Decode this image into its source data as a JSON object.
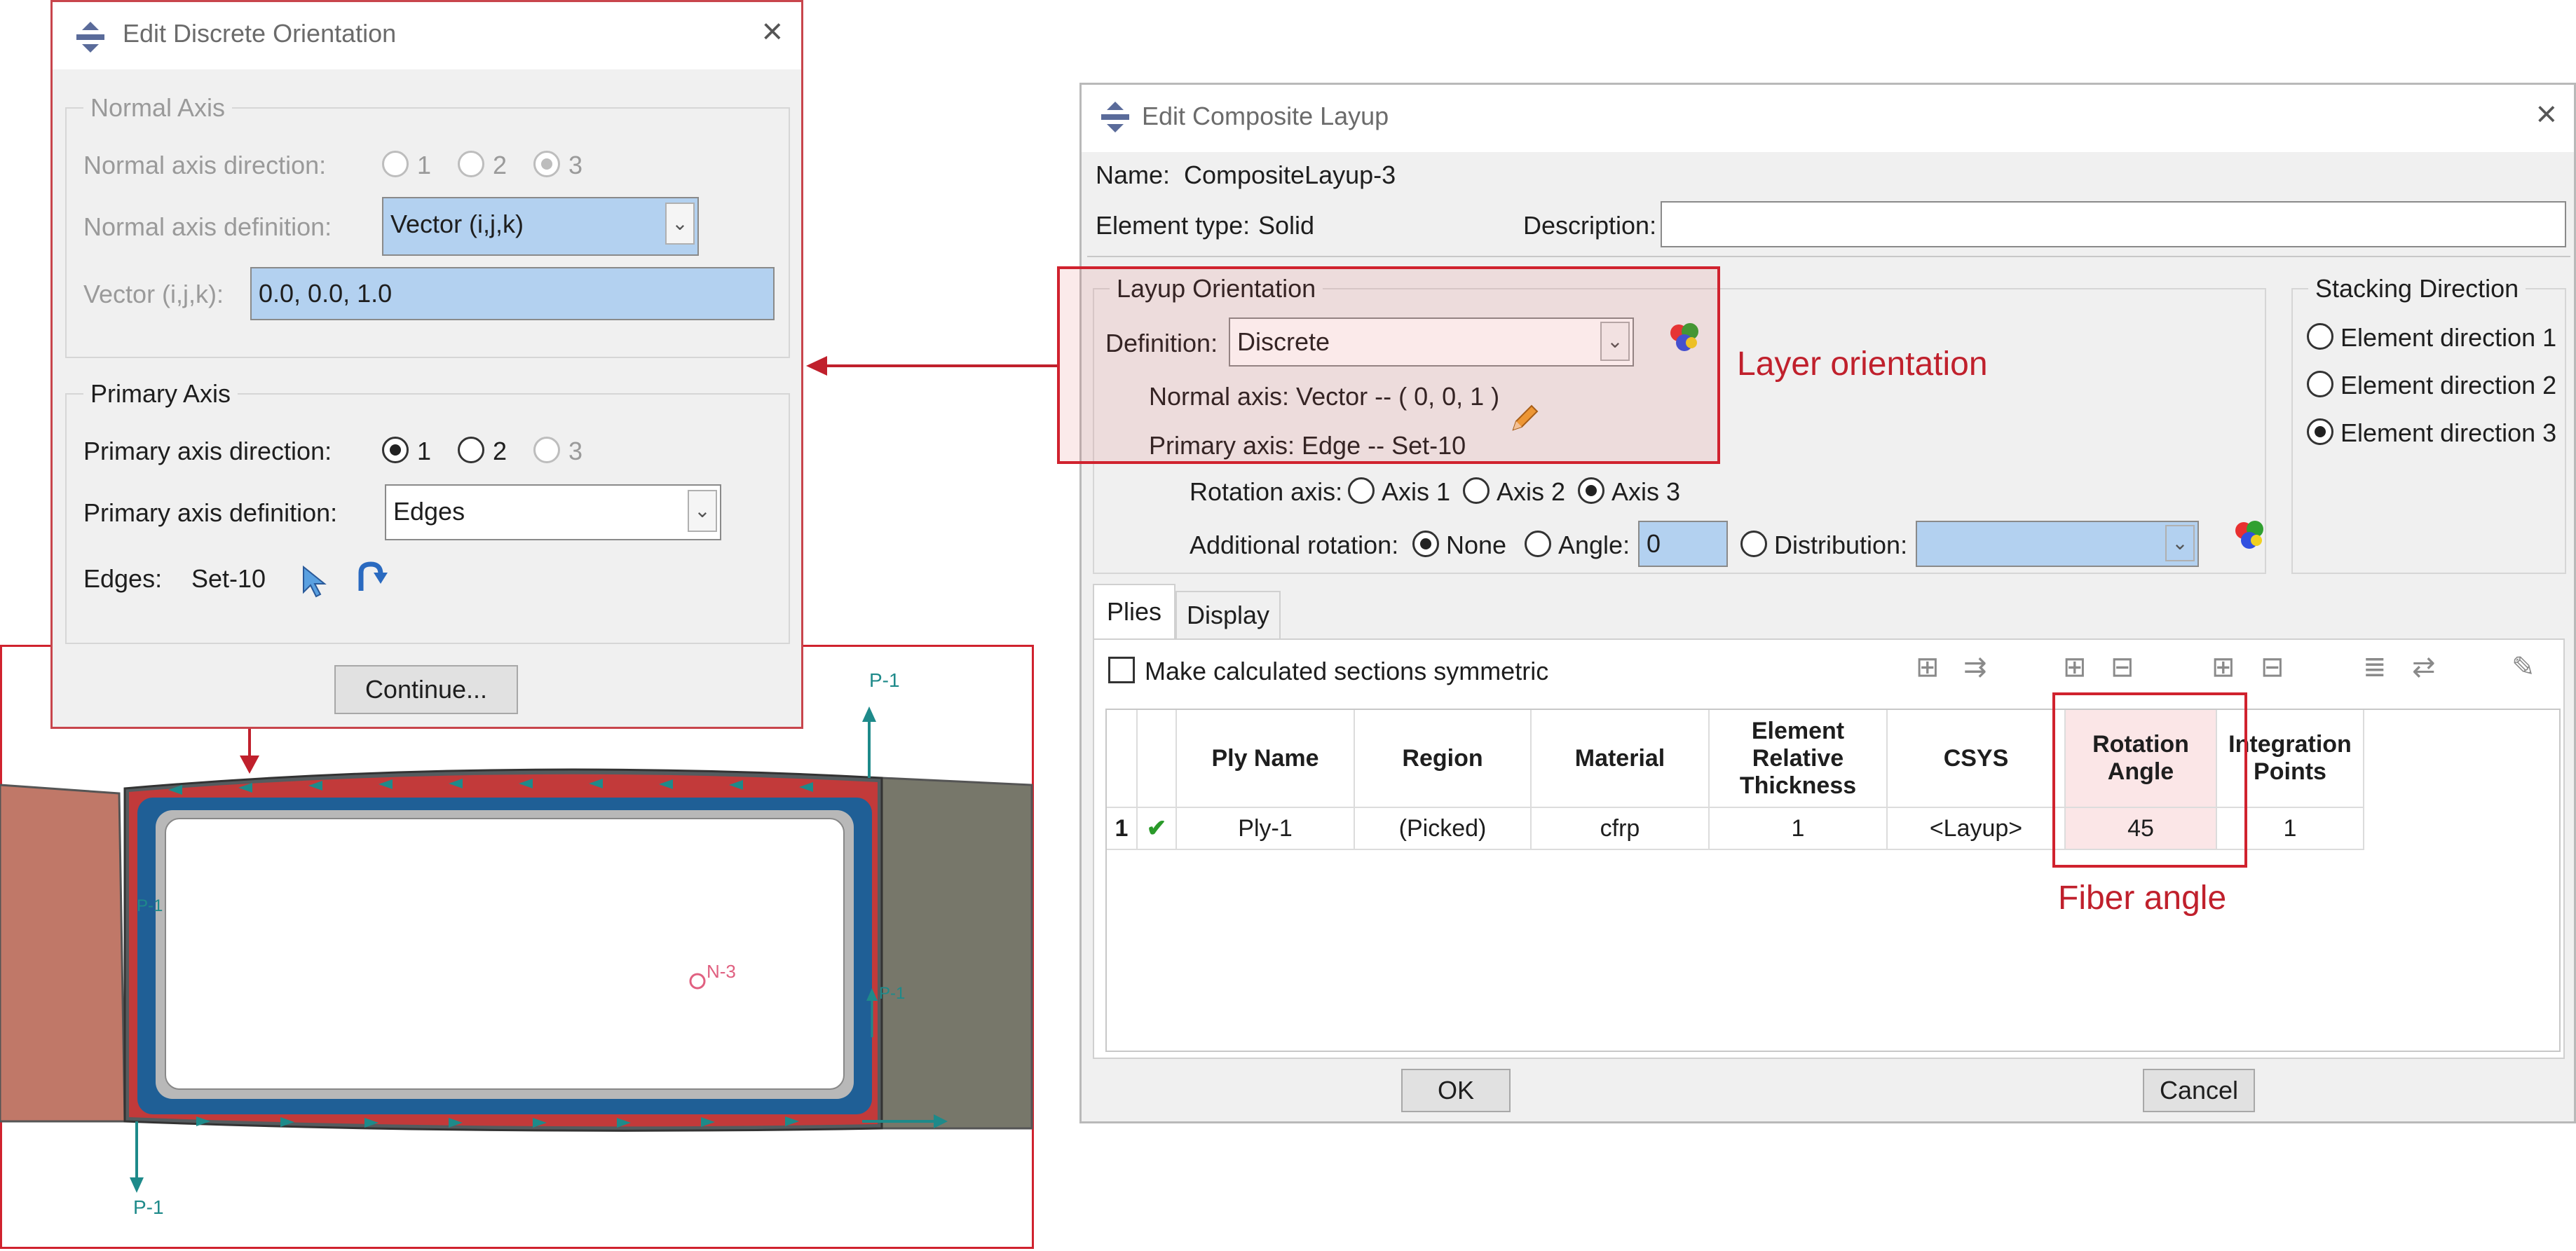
{
  "discrete": {
    "title": "Edit Discrete Orientation",
    "normal_axis": {
      "group": "Normal Axis",
      "direction_label": "Normal axis direction:",
      "dir_options": [
        "1",
        "2",
        "3"
      ],
      "definition_label": "Normal axis definition:",
      "definition_value": "Vector (i,j,k)",
      "vector_label": "Vector (i,j,k):",
      "vector_value": "0.0, 0.0, 1.0"
    },
    "primary_axis": {
      "group": "Primary Axis",
      "direction_label": "Primary axis direction:",
      "dir_options": [
        "1",
        "2",
        "3"
      ],
      "definition_label": "Primary axis definition:",
      "definition_value": "Edges",
      "edges_label": "Edges:",
      "edges_value": "Set-10"
    },
    "continue_label": "Continue..."
  },
  "layup": {
    "title": "Edit Composite Layup",
    "name_label": "Name:",
    "name_value": "CompositeLayup-3",
    "element_type_label": "Element type:",
    "element_type_value": "Solid",
    "description_label": "Description:",
    "orientation": {
      "group": "Layup Orientation",
      "definition_label": "Definition:",
      "definition_value": "Discrete",
      "normal_axis_text": "Normal axis:  Vector -- ( 0, 0, 1 )",
      "primary_axis_text": "Primary axis:  Edge -- Set-10",
      "rotation_axis_label": "Rotation axis:",
      "rotation_options": [
        "Axis 1",
        "Axis 2",
        "Axis 3"
      ],
      "additional_label": "Additional rotation:",
      "none_label": "None",
      "angle_label": "Angle:",
      "angle_value": "0",
      "distribution_label": "Distribution:"
    },
    "stacking": {
      "group": "Stacking Direction",
      "options": [
        "Element direction 1",
        "Element direction 2",
        "Element direction 3"
      ]
    },
    "tabs": [
      "Plies",
      "Display"
    ],
    "symmetric_label": "Make calculated sections symmetric",
    "table": {
      "headers": [
        "Ply Name",
        "Region",
        "Material",
        "Element Relative Thickness",
        "CSYS",
        "Rotation Angle",
        "Integration Points"
      ],
      "row_number": "1",
      "row": [
        "Ply-1",
        "(Picked)",
        "cfrp",
        "1",
        "<Layup>",
        "45",
        "1"
      ]
    },
    "ok_label": "OK",
    "cancel_label": "Cancel"
  },
  "annotations": {
    "layer_orientation": "Layer orientation",
    "fiber_angle": "Fiber angle"
  },
  "viewport": {
    "labels": {
      "p1_top": "P-1",
      "p1_bottom": "P-1",
      "n3": "N-3",
      "p1_right_small": "P-1",
      "p1_left_small": "P-1"
    }
  },
  "colors": {
    "accent_red": "#d0222e",
    "selection_blue": "#b3d1f0",
    "shell_blue": "#1f5f96",
    "left_block": "#c07868",
    "right_block": "#77776a"
  }
}
